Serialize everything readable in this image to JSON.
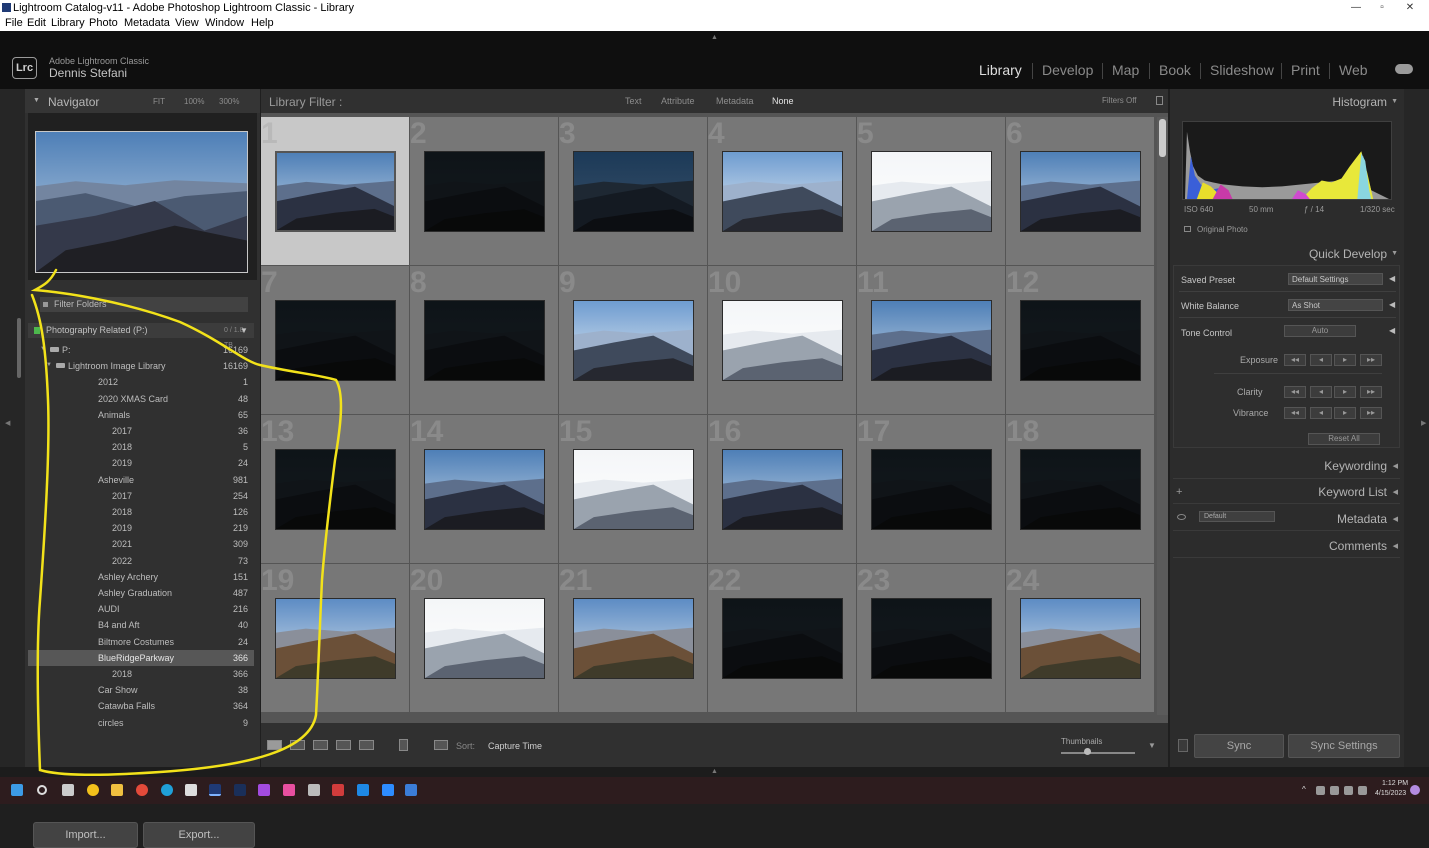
{
  "window": {
    "title": "Lightroom Catalog-v11 - Adobe Photoshop Lightroom Classic - Library"
  },
  "menu": [
    "File",
    "Edit",
    "Library",
    "Photo",
    "Metadata",
    "View",
    "Window",
    "Help"
  ],
  "identity": {
    "product": "Adobe Lightroom Classic",
    "user": "Dennis Stefani",
    "logo": "Lrc"
  },
  "modules": [
    "Library",
    "Develop",
    "Map",
    "Book",
    "Slideshow",
    "Print",
    "Web"
  ],
  "active_module": "Library",
  "navigator": {
    "title": "Navigator",
    "zoom": [
      "FIT",
      "100%",
      "300%"
    ]
  },
  "folders": {
    "filter_placeholder": "Filter Folders",
    "volume": {
      "name": "Photography Related (P:)",
      "size": "0 / 1.8 TB"
    },
    "rows": [
      {
        "name": "P:",
        "count": "16169"
      },
      {
        "name": "Lightroom Image Library",
        "count": "16169"
      },
      {
        "name": "2012",
        "count": "1"
      },
      {
        "name": "2020 XMAS Card",
        "count": "48"
      },
      {
        "name": "Animals",
        "count": "65"
      },
      {
        "name": "2017",
        "count": "36"
      },
      {
        "name": "2018",
        "count": "5"
      },
      {
        "name": "2019",
        "count": "24"
      },
      {
        "name": "Asheville",
        "count": "981"
      },
      {
        "name": "2017",
        "count": "254"
      },
      {
        "name": "2018",
        "count": "126"
      },
      {
        "name": "2019",
        "count": "219"
      },
      {
        "name": "2021",
        "count": "309"
      },
      {
        "name": "2022",
        "count": "73"
      },
      {
        "name": "Ashley Archery",
        "count": "151"
      },
      {
        "name": "Ashley Graduation",
        "count": "487"
      },
      {
        "name": "AUDI",
        "count": "216"
      },
      {
        "name": "B4 and Aft",
        "count": "40"
      },
      {
        "name": "Biltmore Costumes",
        "count": "24"
      },
      {
        "name": "BlueRidgeParkway",
        "count": "366"
      },
      {
        "name": "2018",
        "count": "366"
      },
      {
        "name": "Car Show",
        "count": "38"
      },
      {
        "name": "Catawba Falls",
        "count": "364"
      },
      {
        "name": "circles",
        "count": "9"
      }
    ],
    "selected": "BlueRidgeParkway"
  },
  "buttons": {
    "import": "Import...",
    "export": "Export..."
  },
  "filter_bar": {
    "label": "Library Filter :",
    "options": [
      "Text",
      "Attribute",
      "Metadata",
      "None"
    ],
    "active": "None",
    "state": "Filters Off"
  },
  "grid": {
    "numbers": [
      "1",
      "2",
      "3",
      "4",
      "5",
      "6",
      "7",
      "8",
      "9",
      "10",
      "11",
      "12",
      "13",
      "14",
      "15",
      "16",
      "17",
      "18",
      "19",
      "20",
      "21",
      "22",
      "23",
      "24"
    ],
    "selected_index": 0,
    "thumb_styles": [
      "mountain",
      "dark",
      "darkblue",
      "bright",
      "white",
      "mountain",
      "dark",
      "dark",
      "bright",
      "white",
      "mountain",
      "dark",
      "dark",
      "mountain",
      "white",
      "mountain",
      "dark",
      "dark",
      "autumn",
      "white",
      "autumn",
      "dark",
      "dark",
      "autumn"
    ]
  },
  "toolbar": {
    "sort_label": "Sort:",
    "sort_value": "Capture Time",
    "thumbnails_label": "Thumbnails"
  },
  "histogram": {
    "title": "Histogram",
    "iso": "ISO 640",
    "focal": "50 mm",
    "aperture": "ƒ / 14",
    "shutter": "1/320 sec",
    "original": "Original Photo"
  },
  "quick_develop": {
    "title": "Quick Develop",
    "saved_preset_label": "Saved Preset",
    "saved_preset_value": "Default Settings",
    "white_balance_label": "White Balance",
    "white_balance_value": "As Shot",
    "tone_control_label": "Tone Control",
    "auto_label": "Auto",
    "exposure_label": "Exposure",
    "clarity_label": "Clarity",
    "vibrance_label": "Vibrance",
    "reset_label": "Reset All"
  },
  "right_panels": {
    "keywording": "Keywording",
    "keyword_list": "Keyword List",
    "metadata": "Metadata",
    "metadata_preset": "Default",
    "comments": "Comments"
  },
  "sync": {
    "sync": "Sync",
    "sync_settings": "Sync Settings"
  },
  "clock": {
    "time": "1:12 PM",
    "date": "4/15/2023"
  },
  "colors": {
    "annotation": "#f2e21a",
    "active_module": "#dedede",
    "inactive_module": "#8a8a8a"
  }
}
